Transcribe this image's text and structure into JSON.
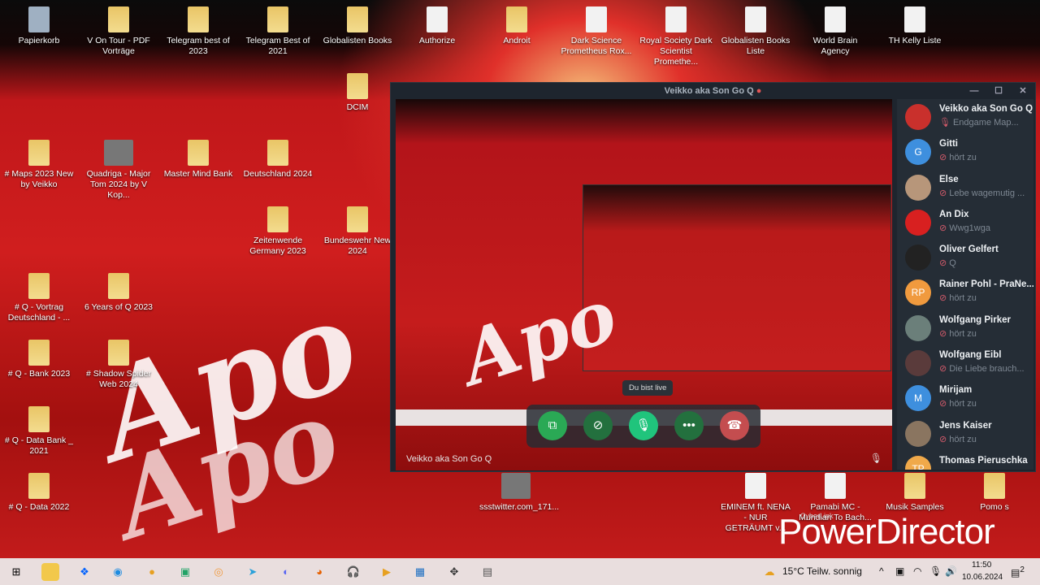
{
  "desktop": {
    "icons": [
      {
        "label": "Papierkorb",
        "type": "bin"
      },
      {
        "label": "V On Tour - PDF Vorträge",
        "type": "fold"
      },
      {
        "label": "Telegram best of 2023",
        "type": "fold"
      },
      {
        "label": "Telegram Best of 2021",
        "type": "fold"
      },
      {
        "label": "Globalisten Books",
        "type": "fold"
      },
      {
        "label": "Authorize",
        "type": "doc"
      },
      {
        "label": "Androit",
        "type": "fold"
      },
      {
        "label": "Dark Science Prometheus Rox...",
        "type": "doc"
      },
      {
        "label": "Royal Society Dark Scientist Promethe...",
        "type": "doc"
      },
      {
        "label": "Globalisten Books Liste",
        "type": "doc"
      },
      {
        "label": "World Brain Agency",
        "type": "doc"
      },
      {
        "label": "TH Kelly Liste",
        "type": "doc"
      },
      {
        "label": "DCIM",
        "type": "fold"
      },
      {
        "label": "# Maps 2023 New by Veikko",
        "type": "fold"
      },
      {
        "label": "Quadriga - Major Tom 2024 by V Kop...",
        "type": "img"
      },
      {
        "label": "Master Mind Bank",
        "type": "fold"
      },
      {
        "label": "Deutschland 2024",
        "type": "fold"
      },
      {
        "label": "Zeitenwende Germany 2023",
        "type": "fold"
      },
      {
        "label": "Bundeswehr New 2024",
        "type": "fold"
      },
      {
        "label": "# Q - Vortrag Deutschland - ...",
        "type": "fold"
      },
      {
        "label": "6 Years of Q 2023",
        "type": "fold"
      },
      {
        "label": "# Q - Bank  2023",
        "type": "fold"
      },
      {
        "label": "# Shadow Spider Web 2024",
        "type": "fold"
      },
      {
        "label": "# Q - Data Bank _ 2021",
        "type": "fold"
      },
      {
        "label": "# Q - Data 2022",
        "type": "fold"
      },
      {
        "label": "ssstwitter.com_171...",
        "type": "img"
      },
      {
        "label": "EMINEM ft. NENA - NUR GETRÄUMT v...",
        "type": "doc"
      },
      {
        "label": "Pamabi MC - Mundian To Bach...",
        "type": "doc"
      },
      {
        "label": "Musik Samples",
        "type": "fold"
      },
      {
        "label": "Pomo s",
        "type": "fold"
      }
    ]
  },
  "graffiti": "Apo",
  "call": {
    "title": "Veikko aka Son Go Q",
    "speaker_name": "Veikko aka Son Go Q",
    "tooltip": "Du bist live",
    "controls": [
      {
        "name": "screen-share",
        "glyph": "⧉",
        "color": "#2aa955"
      },
      {
        "name": "video-off",
        "glyph": "⊘",
        "color": "#23703e"
      },
      {
        "name": "microphone",
        "glyph": "🎙",
        "color": "#20c47c"
      },
      {
        "name": "more",
        "glyph": "•••",
        "color": "#23703e"
      },
      {
        "name": "end-call",
        "glyph": "☎",
        "color": "#c44d4f"
      }
    ],
    "participants": [
      {
        "name": "Veikko aka Son Go Q",
        "status": "Endgame Map...",
        "initials": "",
        "color": "#c9302c",
        "muted": false
      },
      {
        "name": "Gitti",
        "status": "hört zu",
        "initials": "G",
        "color": "#3e8fde",
        "muted": true
      },
      {
        "name": "Else",
        "status": "Lebe wagemutig ...",
        "initials": "",
        "color": "#b7967a",
        "muted": true
      },
      {
        "name": "An Dix",
        "status": "Wwg1wga",
        "initials": "",
        "color": "#d82020",
        "muted": true
      },
      {
        "name": "Oliver Gelfert",
        "status": "Q",
        "initials": "",
        "color": "#222222",
        "muted": true
      },
      {
        "name": "Rainer Pohl - PraNe...",
        "status": "hört zu",
        "initials": "RP",
        "color": "#f09a3e",
        "muted": true
      },
      {
        "name": "Wolfgang Pirker",
        "status": "hört zu",
        "initials": "",
        "color": "#6b7f7a",
        "muted": true
      },
      {
        "name": "Wolfgang Eibl",
        "status": "Die Liebe brauch...",
        "initials": "",
        "color": "#5a3b3b",
        "muted": true
      },
      {
        "name": "Mirijam",
        "status": "hört zu",
        "initials": "M",
        "color": "#3e8fde",
        "muted": true
      },
      {
        "name": "Jens Kaiser",
        "status": "hört zu",
        "initials": "",
        "color": "#8a7560",
        "muted": true
      },
      {
        "name": "Thomas Pieruschka",
        "status": "",
        "initials": "TP",
        "color": "#f0a94a",
        "muted": true
      }
    ]
  },
  "watermark": {
    "brand": "CyberLink",
    "product": "PowerDirector"
  },
  "taskbar": {
    "weather": "15°C  Teilw. sonnig",
    "time": "11:50",
    "date": "10.06.2024",
    "notifications": "2"
  }
}
